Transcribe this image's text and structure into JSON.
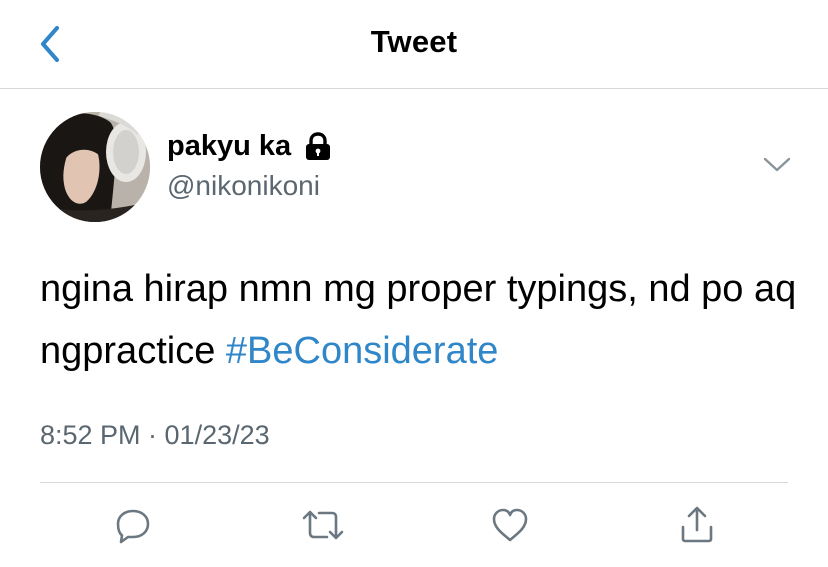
{
  "header": {
    "title": "Tweet",
    "back_icon": "chevron-left-icon"
  },
  "colors": {
    "accent": "#2f86c9",
    "secondary_text": "#5b6770",
    "divider": "#d6d9dc",
    "icon_gray": "#6b7882"
  },
  "tweet": {
    "display_name": "pakyu ka",
    "protected_icon": "lock-icon",
    "handle": "@nikonikoni",
    "more_icon": "chevron-down-icon",
    "text": "ngina hirap nmn mg proper typings, nd po aq ngpractice",
    "hashtag": "#BeConsiderate",
    "timestamp": "8:52 PM · 01/23/23"
  },
  "actions": [
    {
      "name": "reply",
      "icon": "reply-icon"
    },
    {
      "name": "retweet",
      "icon": "retweet-icon"
    },
    {
      "name": "like",
      "icon": "heart-icon"
    },
    {
      "name": "share",
      "icon": "share-icon"
    }
  ]
}
